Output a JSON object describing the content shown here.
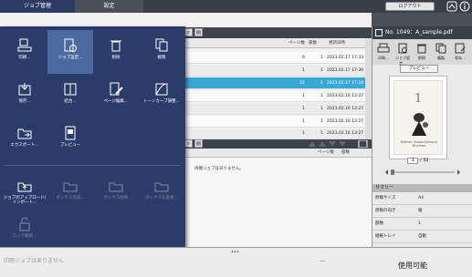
{
  "tabs": [
    {
      "label": "ジョブ管理"
    },
    {
      "label": "設定"
    }
  ],
  "header": {
    "logout_label": "ログアウト"
  },
  "menu": {
    "items": [
      {
        "label": "印刷..."
      },
      {
        "label": "ジョブ設定..."
      },
      {
        "label": "削除"
      },
      {
        "label": "複製"
      },
      {
        "label": "保存..."
      },
      {
        "label": "結合..."
      },
      {
        "label": "ページ編集..."
      },
      {
        "label": "トーンカーブ調整..."
      },
      {
        "label": "エクスポート..."
      },
      {
        "label": "プレビュー"
      },
      {
        "label": "ジョブのアップロード/インポート..."
      },
      {
        "label": "ボックス作成..."
      },
      {
        "label": "ボックス削除"
      },
      {
        "label": "ボックスを変更..."
      },
      {
        "label": "ロック解除..."
      }
    ]
  },
  "job_table": {
    "columns": [
      "ページ数",
      "部数",
      "更新日時"
    ],
    "rows": [
      {
        "pages": "6",
        "copies": "1",
        "updated": "2023.02.17 17:33"
      },
      {
        "pages": "1",
        "copies": "1",
        "updated": "2023.02.17 17:30"
      },
      {
        "pages": "32",
        "copies": "1",
        "updated": "2023.02.17 17:28"
      },
      {
        "pages": "1",
        "copies": "1",
        "updated": "2023.02.16 13:27"
      },
      {
        "pages": "1",
        "copies": "1",
        "updated": "2023.02.16 13:27"
      },
      {
        "pages": "1",
        "copies": "1",
        "updated": "2023.02.16 13:27"
      },
      {
        "pages": "1",
        "copies": "1",
        "updated": "2023.02.16 13:27"
      }
    ]
  },
  "lower_table": {
    "column": "ページ数",
    "column2": "部数",
    "empty_message": "待機ジョブはありません。"
  },
  "detail": {
    "title": "No. 1049：A_sample.pdf",
    "icon_labels": [
      "印刷...",
      "ジョブ設定...",
      "削除",
      "複製",
      "保存..."
    ],
    "preview_button": "プレビュー",
    "page_current": "1",
    "page_total": "/ 32",
    "thumb_number": "1",
    "thumb_caption": "Mother Goose Nursery Rhymes",
    "summary_title": "サマリー",
    "summary": [
      {
        "key": "原稿サイズ",
        "value": "A4"
      },
      {
        "key": "原稿の向き",
        "value": "縦"
      },
      {
        "key": "部数",
        "value": "1"
      },
      {
        "key": "給紙トレイ",
        "value": "自動"
      }
    ]
  },
  "status": {
    "text": "使用可能",
    "ghost_text": "印刷ジョブはありません",
    "dash": "—"
  },
  "colors": {
    "menu_bg": "#2c3c6a",
    "menu_highlight": "#4d6aa0",
    "selected_row": "#39a8d8"
  }
}
